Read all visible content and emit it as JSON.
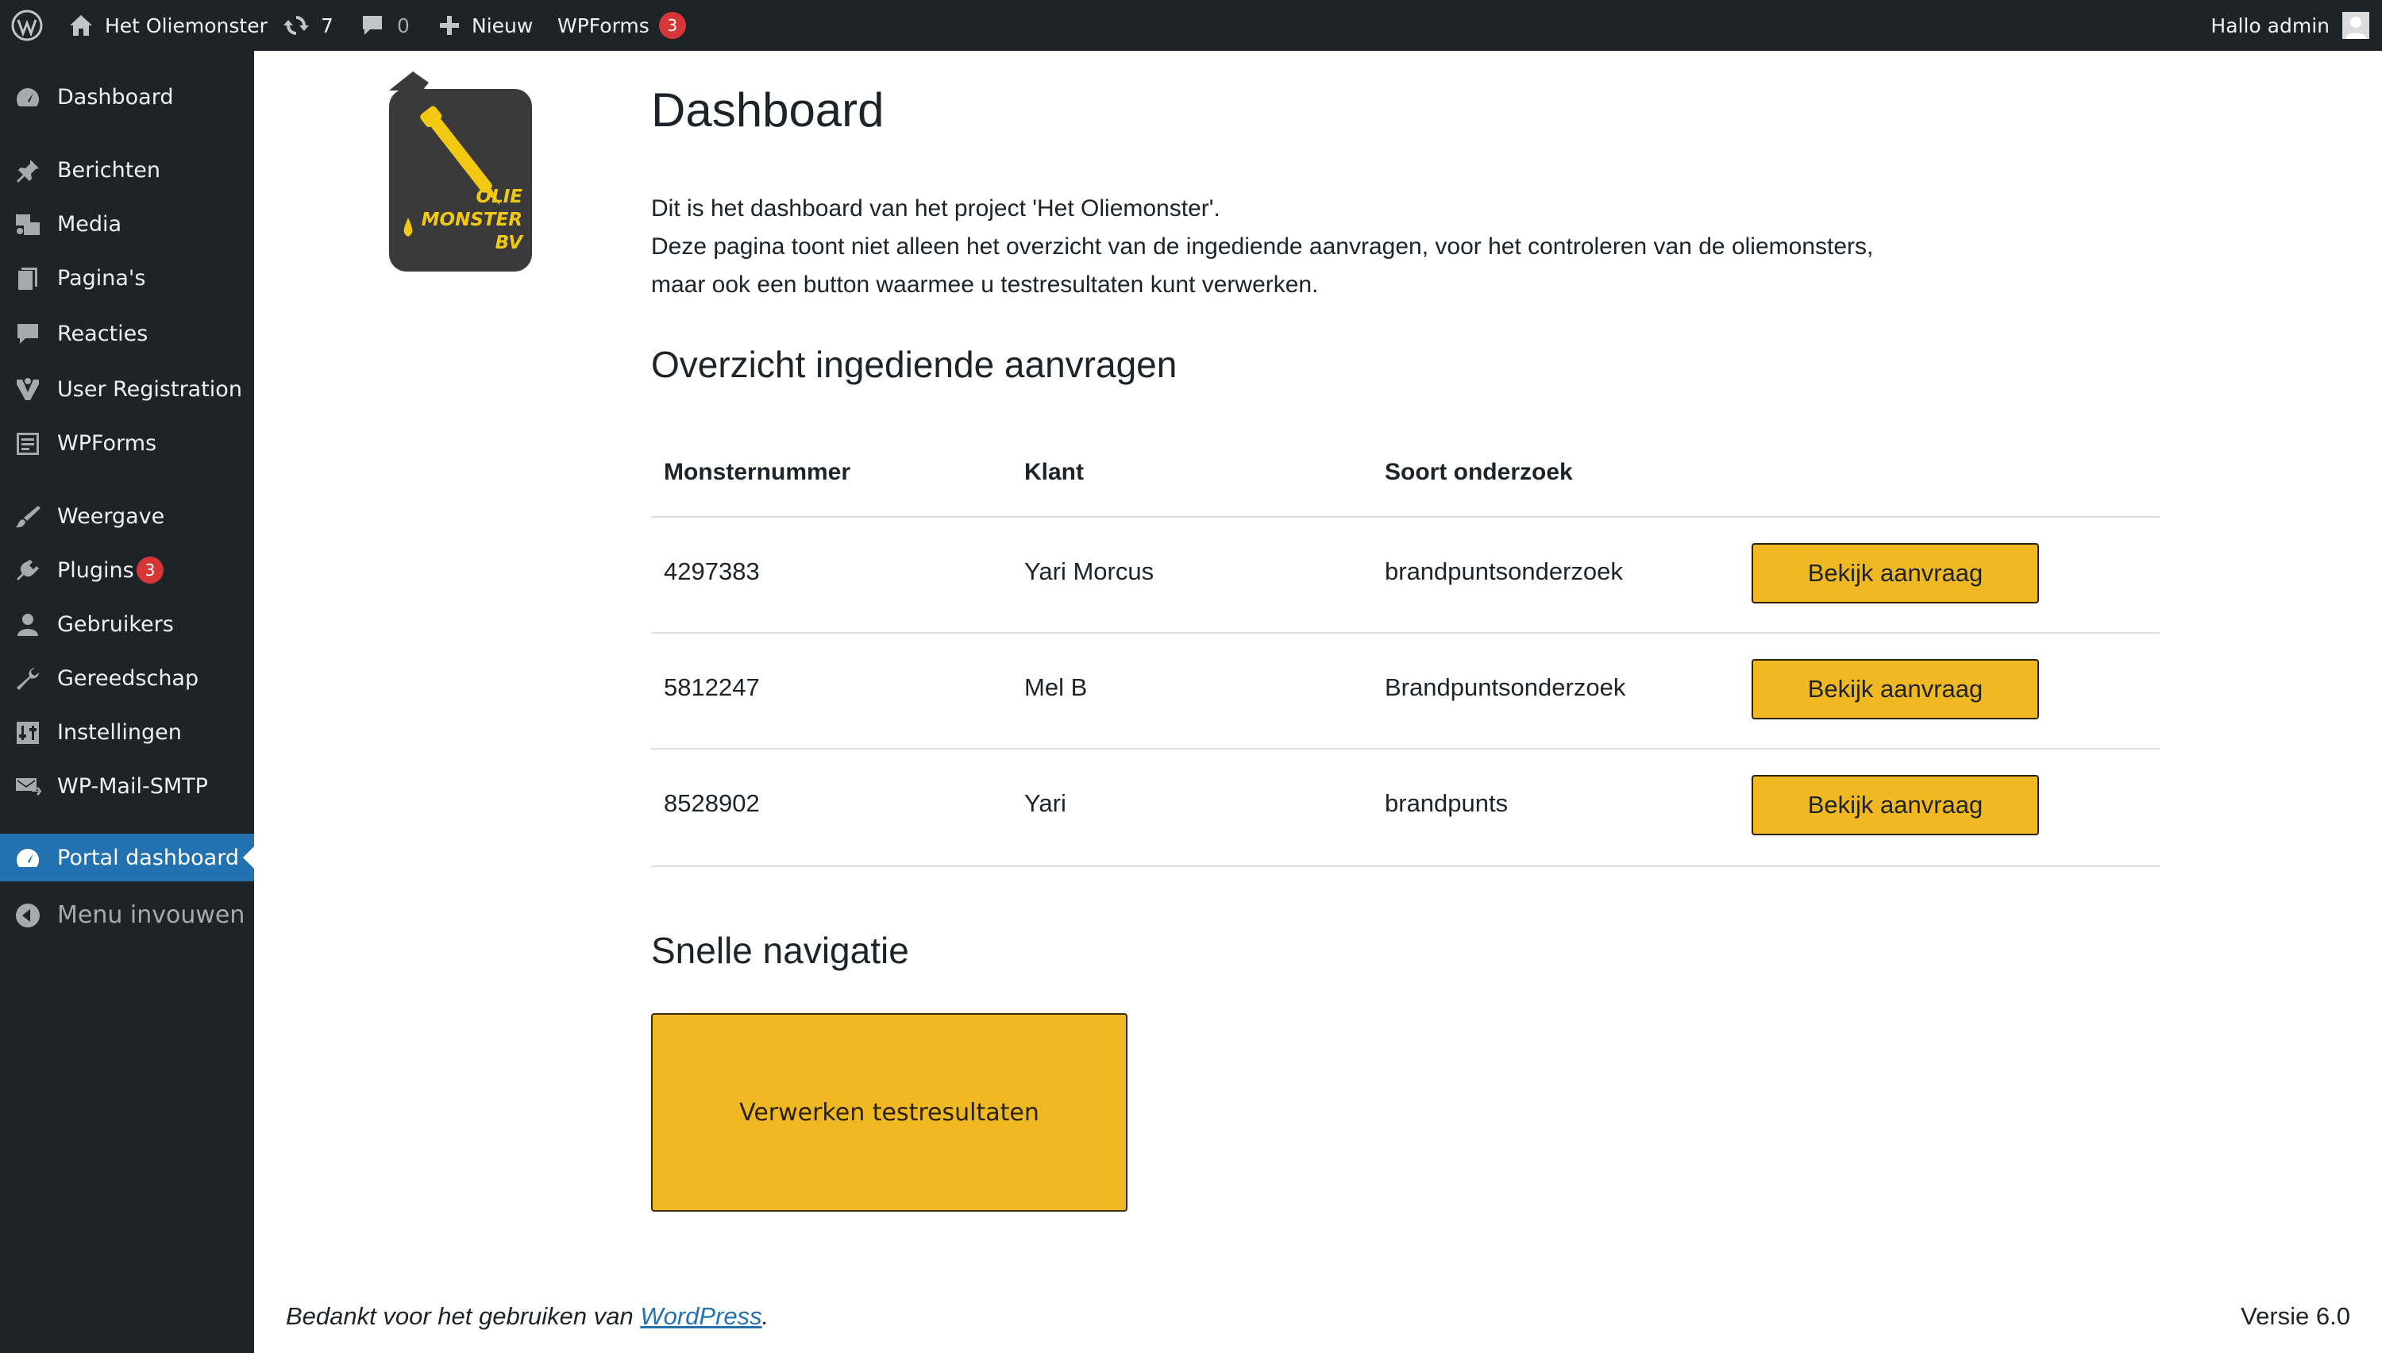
{
  "adminbar": {
    "site_name": "Het Oliemonster",
    "updates_count": "7",
    "comments_count": "0",
    "new_label": "Nieuw",
    "wpforms_label": "WPForms",
    "wpforms_badge": "3",
    "greeting": "Hallo admin",
    "icons": [
      "wordpress-logo-icon",
      "home-icon",
      "updates-icon",
      "comment-icon",
      "plus-icon",
      "avatar-icon"
    ]
  },
  "sidebar": {
    "items": [
      {
        "label": "Dashboard",
        "icon": "dashboard-icon"
      },
      {
        "label": "Berichten",
        "icon": "pin-icon"
      },
      {
        "label": "Media",
        "icon": "media-icon"
      },
      {
        "label": "Pagina's",
        "icon": "pages-icon"
      },
      {
        "label": "Reacties",
        "icon": "comment-icon"
      },
      {
        "label": "User Registration",
        "icon": "user-registration-icon"
      },
      {
        "label": "WPForms",
        "icon": "forms-icon"
      },
      {
        "label": "Weergave",
        "icon": "appearance-icon"
      },
      {
        "label": "Plugins",
        "icon": "plugins-icon",
        "badge": "3"
      },
      {
        "label": "Gebruikers",
        "icon": "users-icon"
      },
      {
        "label": "Gereedschap",
        "icon": "tools-icon"
      },
      {
        "label": "Instellingen",
        "icon": "settings-icon"
      },
      {
        "label": "WP-Mail-SMTP",
        "icon": "mail-icon"
      },
      {
        "label": "Portal dashboard",
        "icon": "dashboard-icon",
        "current": true
      },
      {
        "label": "Menu invouwen",
        "icon": "collapse-icon"
      }
    ]
  },
  "logo": {
    "text_line1": "OLIE",
    "text_line2": "MONSTER",
    "text_line3": "BV"
  },
  "main": {
    "title": "Dashboard",
    "intro_line1": "Dit is het dashboard van het project 'Het Oliemonster'.",
    "intro_line2": "Deze pagina toont niet alleen het overzicht van de ingediende aanvragen, voor het controleren van de oliemonsters,",
    "intro_line3": "maar ook een button waarmee u testresultaten kunt verwerken.",
    "requests_heading": "Overzicht ingediende aanvragen",
    "table": {
      "headers": [
        "Monsternummer",
        "Klant",
        "Soort onderzoek"
      ],
      "rows": [
        {
          "nummer": "4297383",
          "klant": "Yari Morcus",
          "soort": "brandpuntsonderzoek",
          "button": "Bekijk aanvraag"
        },
        {
          "nummer": "5812247",
          "klant": "Mel B",
          "soort": "Brandpuntsonderzoek",
          "button": "Bekijk aanvraag"
        },
        {
          "nummer": "8528902",
          "klant": "Yari",
          "soort": "brandpunts",
          "button": "Bekijk aanvraag"
        }
      ]
    },
    "quick_nav_heading": "Snelle navigatie",
    "quick_nav_button": "Verwerken testresultaten"
  },
  "footer": {
    "thanks_prefix": "Bedankt voor het gebruiken van ",
    "thanks_link": "WordPress",
    "thanks_suffix": ".",
    "version": "Versie 6.0"
  },
  "colors": {
    "adminbar_bg": "#1d2327",
    "sidebar_bg": "#1d2327",
    "current_item_bg": "#2271b1",
    "button_yellow": "#f0b823",
    "badge_red": "#d63638",
    "link_blue": "#2271b1"
  }
}
